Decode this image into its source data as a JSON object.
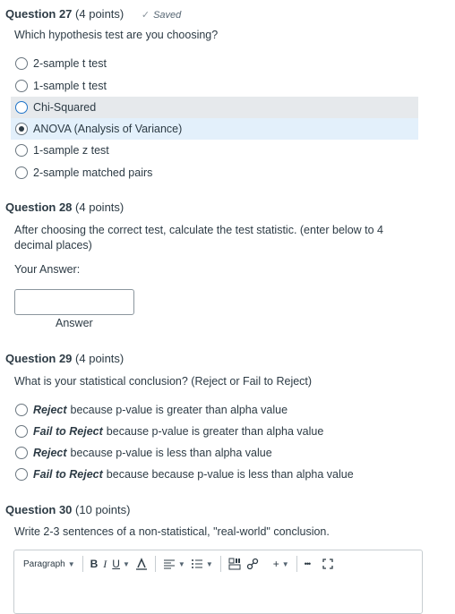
{
  "q27": {
    "number": "Question 27",
    "points": "(4 points)",
    "saved": "Saved",
    "prompt": "Which hypothesis test are you choosing?",
    "options": [
      "2-sample t test",
      "1-sample t test",
      "Chi-Squared",
      "ANOVA (Analysis of Variance)",
      "1-sample z test",
      "2-sample matched pairs"
    ],
    "selected_option": "ANOVA (Analysis of Variance)",
    "hovered_option": "Chi-Squared"
  },
  "q28": {
    "number": "Question 28",
    "points": "(4 points)",
    "prompt": "After choosing the correct test, calculate the test statistic. (enter below to 4 decimal places)",
    "your_answer_label": "Your Answer:",
    "answer_value": "",
    "answer_caption": "Answer"
  },
  "q29": {
    "number": "Question 29",
    "points": "(4 points)",
    "prompt": "What is your statistical conclusion? (Reject or Fail to Reject)",
    "options": [
      {
        "emph": "Reject",
        "rest": "because p-value is greater than alpha value"
      },
      {
        "emph": "Fail to Reject",
        "rest": "because p-value is greater than alpha value"
      },
      {
        "emph": "Reject",
        "rest": "because p-value is less than alpha value"
      },
      {
        "emph": "Fail to Reject",
        "rest": "because because p-value is less than alpha value"
      }
    ]
  },
  "q30": {
    "number": "Question 30",
    "points": "(10 points)",
    "prompt": "Write 2-3 sentences of a non-statistical, \"real-world\" conclusion.",
    "toolbar": {
      "block_format": "Paragraph",
      "bold": "B",
      "italic": "I",
      "underline": "U",
      "plus": "+",
      "more": "•••"
    }
  },
  "colors": {
    "text": "#2d3b45",
    "hover_bg": "#e6e9ec",
    "selected_bg": "#e3f0fb",
    "focus": "#1f74c9"
  }
}
